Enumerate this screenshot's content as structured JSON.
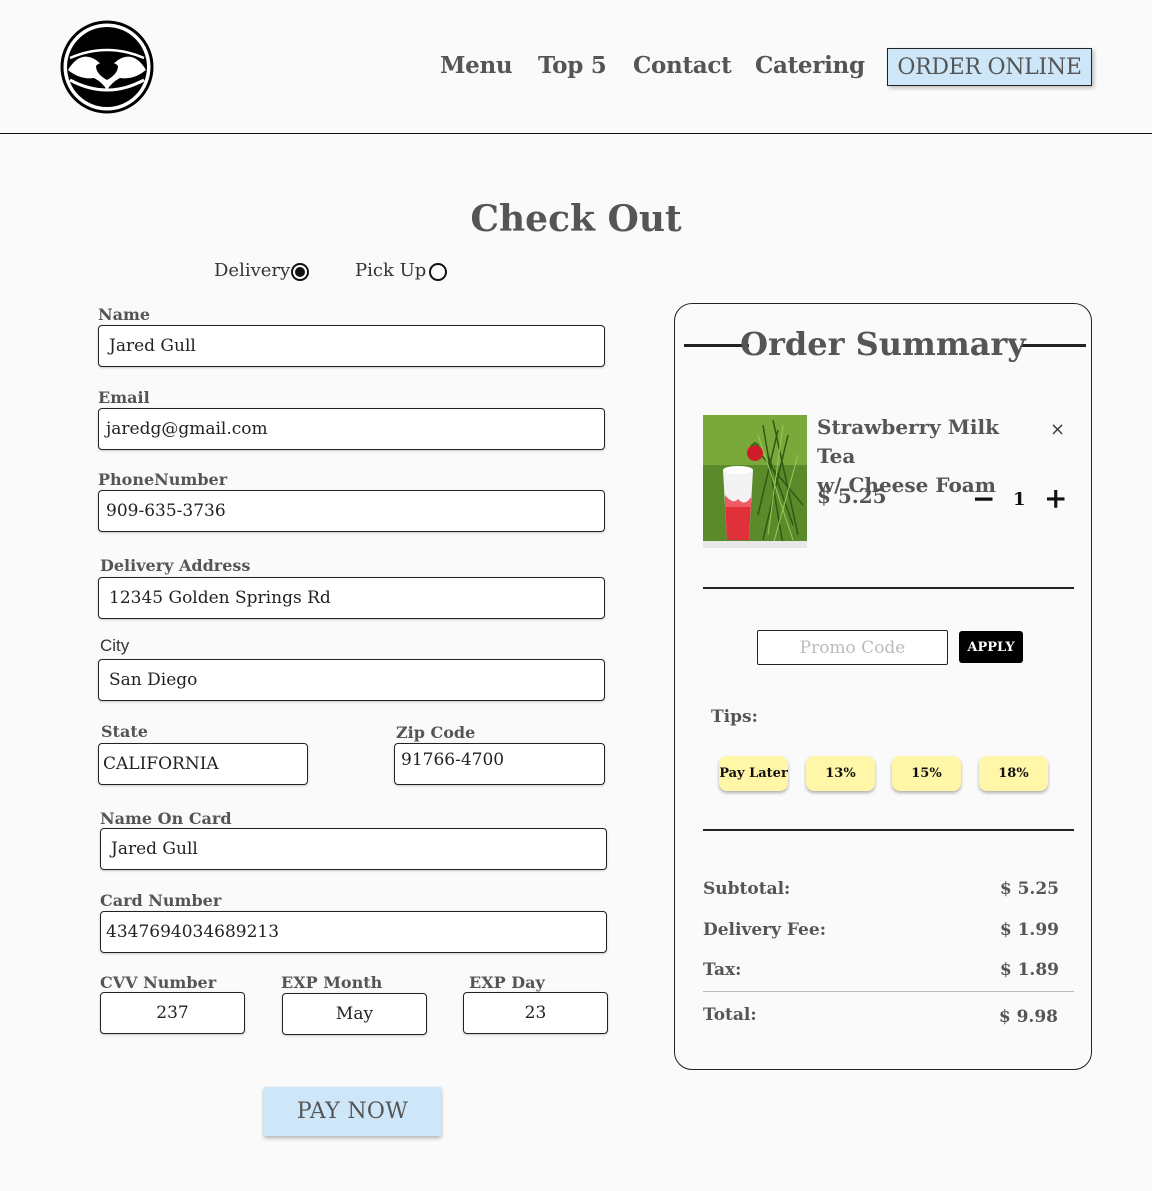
{
  "nav": {
    "items": [
      "Menu",
      "Top 5",
      "Contact",
      "Catering"
    ],
    "order_online": "ORDER ONLINE"
  },
  "page_title": "Check Out",
  "fulfillment": {
    "delivery_label": "Delivery",
    "pickup_label": "Pick Up",
    "selected": "Delivery"
  },
  "form": {
    "name": {
      "label": "Name",
      "value": "Jared Gull"
    },
    "email": {
      "label": "Email",
      "value": "jaredg@gmail.com"
    },
    "phone": {
      "label": "PhoneNumber",
      "value": "909-635-3736"
    },
    "address": {
      "label": "Delivery Address",
      "value": "12345 Golden Springs Rd"
    },
    "city": {
      "label": "City",
      "value": "San Diego"
    },
    "state": {
      "label": "State",
      "value": "CALIFORNIA"
    },
    "zip": {
      "label": "Zip Code",
      "value": "91766-4700"
    },
    "card_name": {
      "label": "Name On Card",
      "value": "Jared Gull"
    },
    "card_number": {
      "label": "Card Number",
      "value": "4347694034689213"
    },
    "cvv": {
      "label": "CVV Number",
      "value": "237"
    },
    "exp_month": {
      "label": "EXP Month",
      "value": "May"
    },
    "exp_day": {
      "label": "EXP Day",
      "value": "23"
    },
    "pay_button": "PAY NOW"
  },
  "summary": {
    "title": "Order Summary",
    "item": {
      "name_line1": "Strawberry Milk Tea",
      "name_line2": "w/ Cheese Foam",
      "price": "$ 5.25",
      "quantity": "1",
      "minus": "−",
      "plus": "+",
      "remove": "×"
    },
    "promo_placeholder": "Promo Code",
    "apply_label": "APPLY",
    "tips_label": "Tips:",
    "tips": [
      "Pay Later",
      "13%",
      "15%",
      "18%"
    ],
    "subtotal_label": "Subtotal:",
    "subtotal": "$ 5.25",
    "delivery_fee_label": "Delivery Fee:",
    "delivery_fee": "$ 1.99",
    "tax_label": "Tax:",
    "tax": "$ 1.89",
    "total_label": "Total:",
    "total": "$ 9.98"
  },
  "colors": {
    "accent_blue": "#cde7f8",
    "tip_yellow": "#fff6a8",
    "background": "#fafafa"
  }
}
